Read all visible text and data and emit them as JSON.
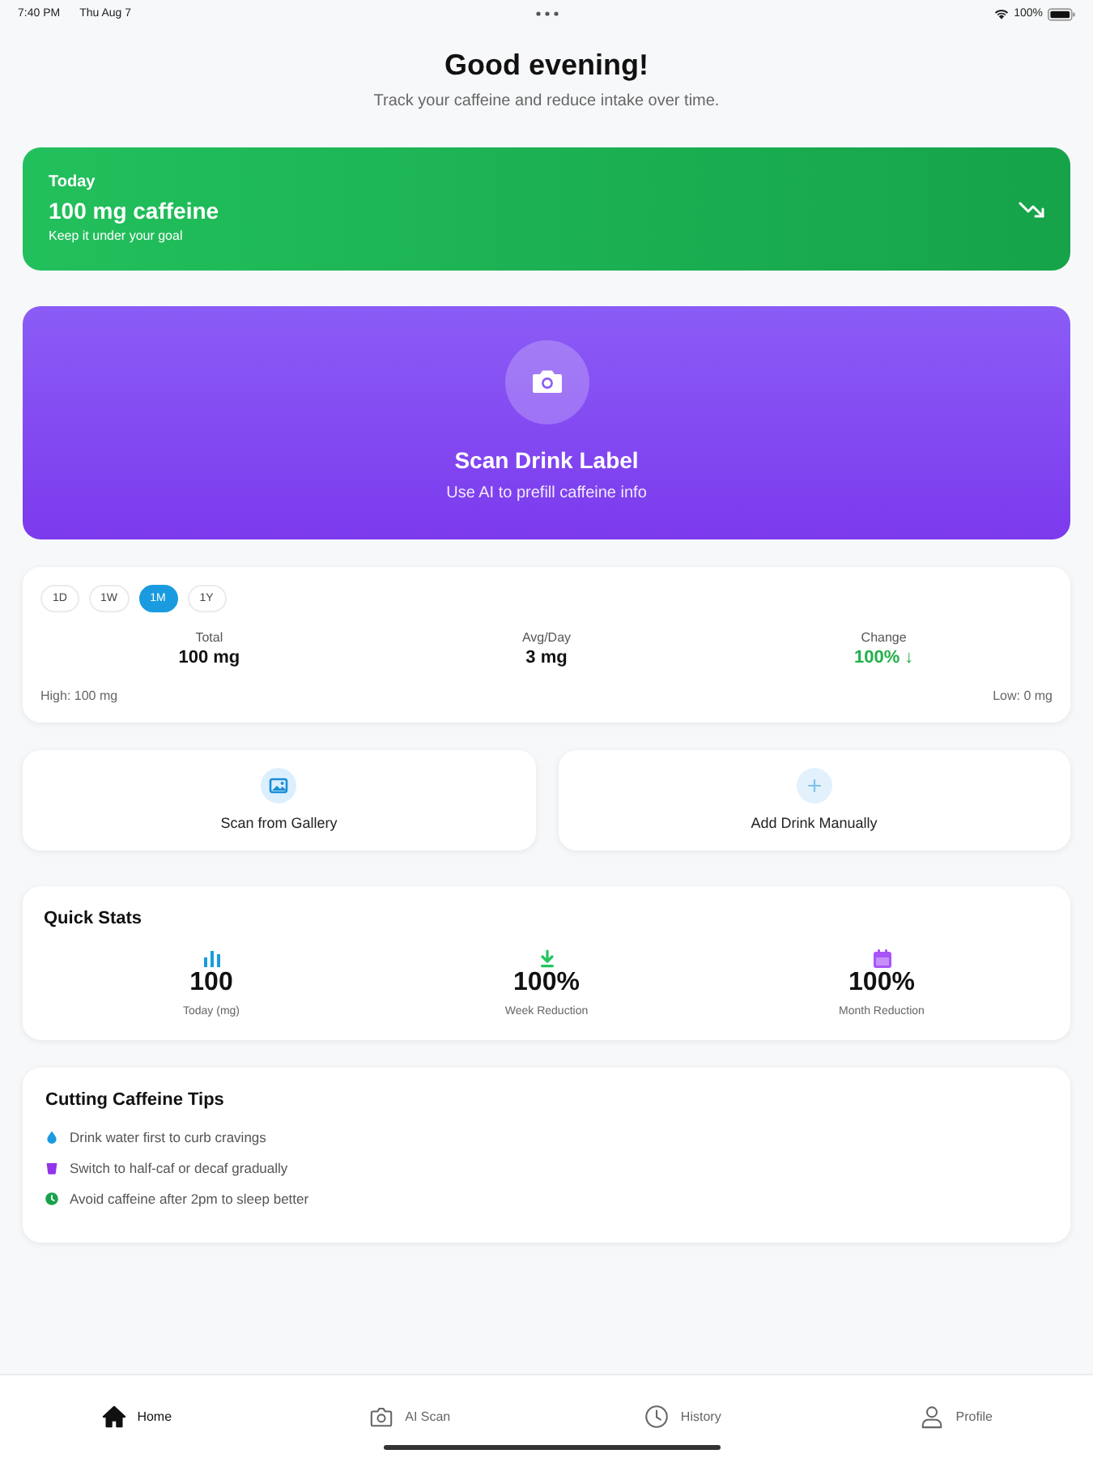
{
  "status_bar": {
    "time": "7:40 PM",
    "date": "Thu Aug 7",
    "battery": "100%"
  },
  "header": {
    "title": "Good evening!",
    "subtitle": "Track your caffeine and reduce intake over time."
  },
  "today_card": {
    "label": "Today",
    "amount": "100 mg caffeine",
    "note": "Keep it under your goal"
  },
  "scan_card": {
    "title": "Scan Drink Label",
    "subtitle": "Use AI to prefill caffeine info"
  },
  "summary": {
    "ranges": [
      {
        "label": "1D",
        "selected": false
      },
      {
        "label": "1W",
        "selected": false
      },
      {
        "label": "1M",
        "selected": true
      },
      {
        "label": "1Y",
        "selected": false
      }
    ],
    "stats": [
      {
        "label": "Total",
        "value": "100 mg",
        "kind": "plain"
      },
      {
        "label": "Avg/Day",
        "value": "3 mg",
        "kind": "plain"
      },
      {
        "label": "Change",
        "value": "100% ↓",
        "kind": "decrease"
      }
    ],
    "high": "High: 100 mg",
    "low": "Low: 0 mg"
  },
  "actions": [
    {
      "label": "Scan from Gallery",
      "kind": "gallery"
    },
    {
      "label": "Add Drink Manually",
      "kind": "add"
    }
  ],
  "quick_stats": {
    "title": "Quick Stats",
    "items": [
      {
        "value": "100",
        "label": "Today (mg)",
        "kind": "chart",
        "color": "#1a9be0"
      },
      {
        "value": "100%",
        "label": "Week Reduction",
        "kind": "arrow",
        "color": "#22c55e"
      },
      {
        "value": "100%",
        "label": "Month Reduction",
        "kind": "calendar",
        "color": "#a855f7"
      }
    ]
  },
  "tips": {
    "title": "Cutting Caffeine Tips",
    "items": [
      {
        "text": "Drink water first to curb cravings",
        "kind": "drop",
        "color": "#1a9be0"
      },
      {
        "text": "Switch to half-caf or decaf gradually",
        "kind": "cup",
        "color": "#9333ea"
      },
      {
        "text": "Avoid caffeine after 2pm to sleep better",
        "kind": "clock",
        "color": "#16a34a"
      }
    ]
  },
  "tabs": [
    {
      "label": "Home",
      "kind": "home",
      "selected": true
    },
    {
      "label": "AI Scan",
      "kind": "camera",
      "selected": false
    },
    {
      "label": "History",
      "kind": "history",
      "selected": false
    },
    {
      "label": "Profile",
      "kind": "profile",
      "selected": false
    }
  ]
}
